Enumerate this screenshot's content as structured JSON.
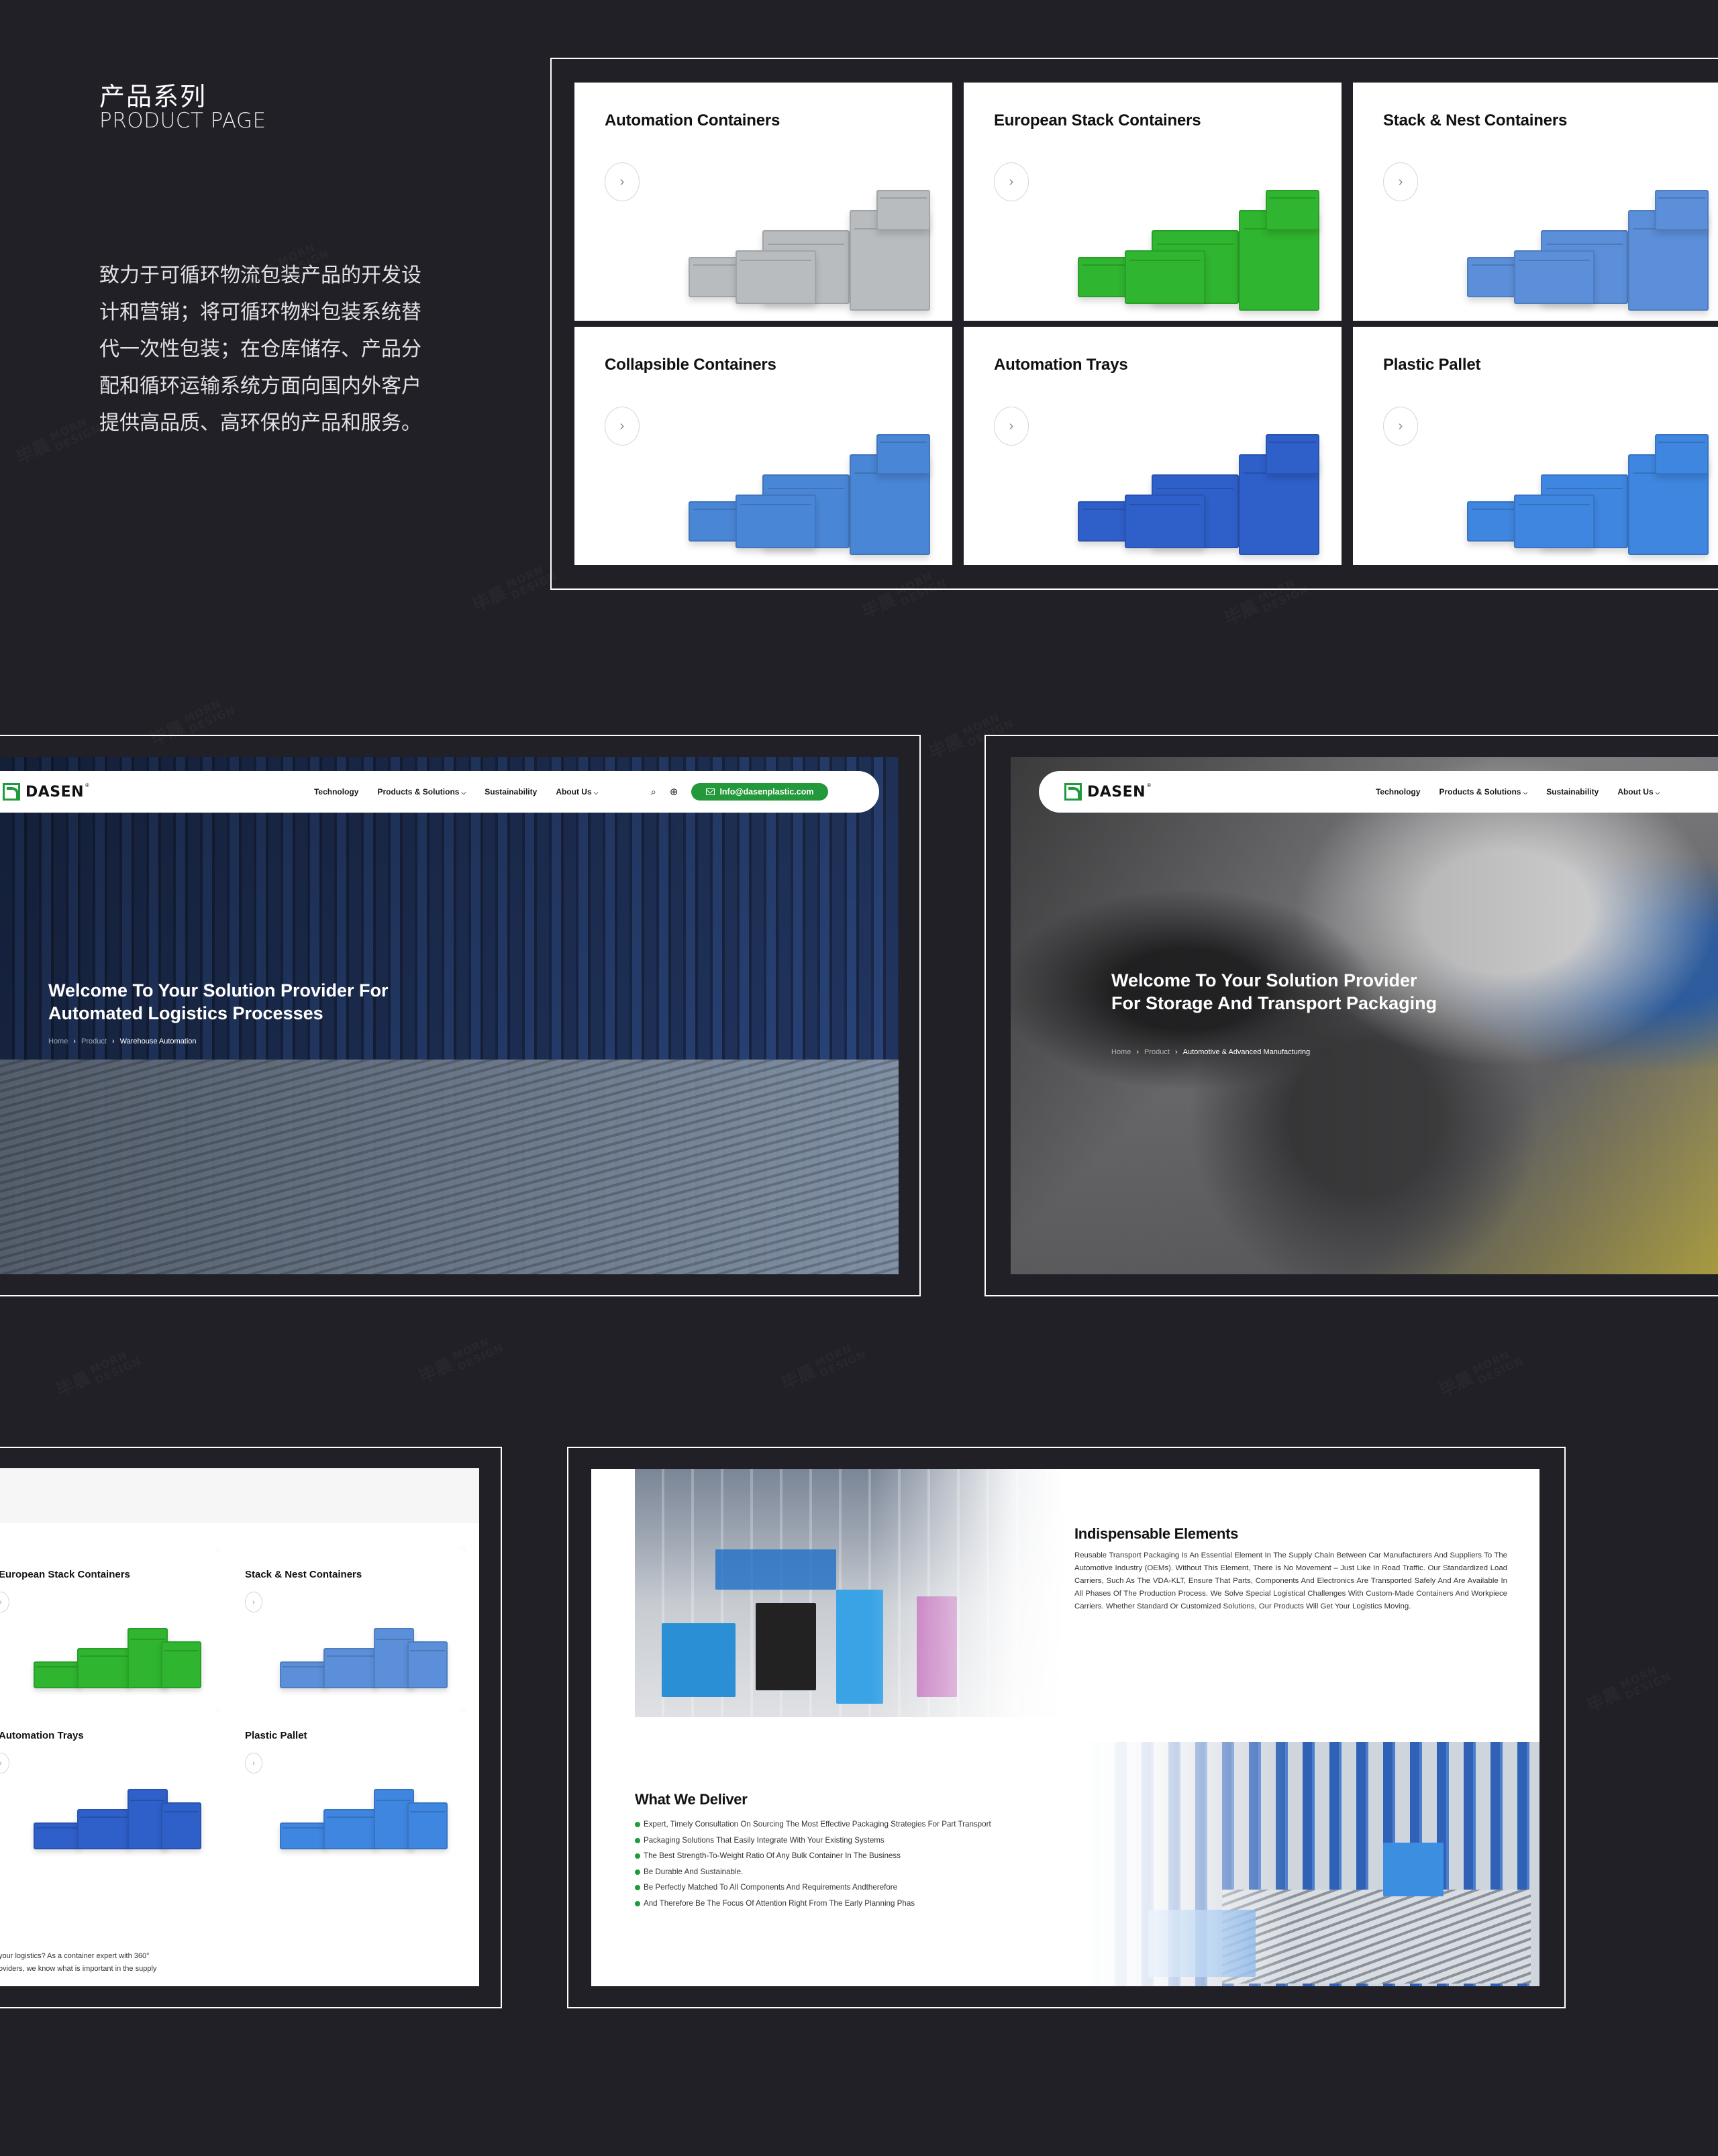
{
  "intro": {
    "title_cn": "产品系列",
    "title_en": "PRODUCT PAGE",
    "description": "致力于可循环物流包装产品的开发设计和营销；将可循环物料包装系统替代一次性包装；在仓库储存、产品分配和循环运输系统方面向国内外客户提供高品质、高环保的产品和服务。"
  },
  "watermark": {
    "cn": "毕晨",
    "en_1": "MORN",
    "en_2": "DESIGN"
  },
  "product_grid": {
    "arrow_icon": "chevron-right-icon",
    "arrow_glyph": "›",
    "cards": [
      {
        "title": "Automation Containers",
        "color": "#b9bcbf"
      },
      {
        "title": "European Stack Containers",
        "color": "#2fb52f"
      },
      {
        "title": "Stack & Nest Containers",
        "color": "#5b8fd9"
      },
      {
        "title": "Collapsible Containers",
        "color": "#4a86d6"
      },
      {
        "title": "Automation Trays",
        "color": "#2f5fc9"
      },
      {
        "title": "Plastic Pallet",
        "color": "#3f86e0"
      }
    ]
  },
  "site": {
    "brand": "DASEN",
    "registered": "®",
    "brand_color": "#1f9b3b",
    "nav": [
      {
        "label": "Technology",
        "dropdown": false
      },
      {
        "label": "Products & Solutions",
        "dropdown": true
      },
      {
        "label": "Sustainability",
        "dropdown": false
      },
      {
        "label": "About Us",
        "dropdown": true
      }
    ],
    "dropdown_glyph": "⌵",
    "search_icon": "⌕",
    "globe_icon": "⊕",
    "email": "Info@dasenplastic.com"
  },
  "hero_warehouse": {
    "title": "Welcome To Your Solution Provider For Automated Logistics Processes",
    "breadcrumb": [
      "Home",
      "Product",
      "Warehouse Automation"
    ],
    "separator": "›"
  },
  "hero_automotive": {
    "title": "Welcome To Your Solution Provider For Storage And Transport Packaging",
    "breadcrumb": [
      "Home",
      "Product",
      "Automotive & Advanced Manufacturing"
    ],
    "separator": "›"
  },
  "mini_grid": {
    "cards": [
      {
        "title": "European Stack Containers",
        "color": "#2fb52f"
      },
      {
        "title": "Stack & Nest Containers",
        "color": "#5b8fd9"
      },
      {
        "title": "Automation Trays",
        "color": "#2f5fc9"
      },
      {
        "title": "Plastic Pallet",
        "color": "#3f86e0"
      }
    ],
    "footer_text_1": "your logistics? As a container expert with 360°",
    "footer_text_2": "oviders, we know what is important in the supply"
  },
  "detail_page": {
    "section_1_title": "Indispensable Elements",
    "section_1_body": "Reusable Transport Packaging Is An Essential Element In The Supply Chain Between Car Manufacturers And Suppliers To The Automotive Industry (OEMs). Without This Element, There Is No Movement – Just Like In Road Traffic. Our Standardized Load Carriers, Such As The VDA-KLT, Ensure That Parts, Components And Electronics Are Transported Safely And Are Available In All Phases Of The Production Process. We Solve Special Logistical Challenges With Custom-Made Containers And Workpiece Carriers. Whether Standard Or Customized Solutions, Our Products Will Get Your Logistics Moving.",
    "section_2_title": "What We Deliver",
    "deliver_items": [
      "Expert, Timely Consultation On Sourcing The Most Effective Packaging Strategies For Part Transport",
      "Packaging Solutions That Easily Integrate With Your Existing Systems",
      "The Best Strength-To-Weight Ratio Of Any Bulk Container In The Business",
      "Be Durable And Sustainable.",
      "Be Perfectly Matched To All Components And Requirements Andtherefore",
      "And Therefore Be The Focus Of Attention Right From The Early Planning Phas"
    ]
  }
}
